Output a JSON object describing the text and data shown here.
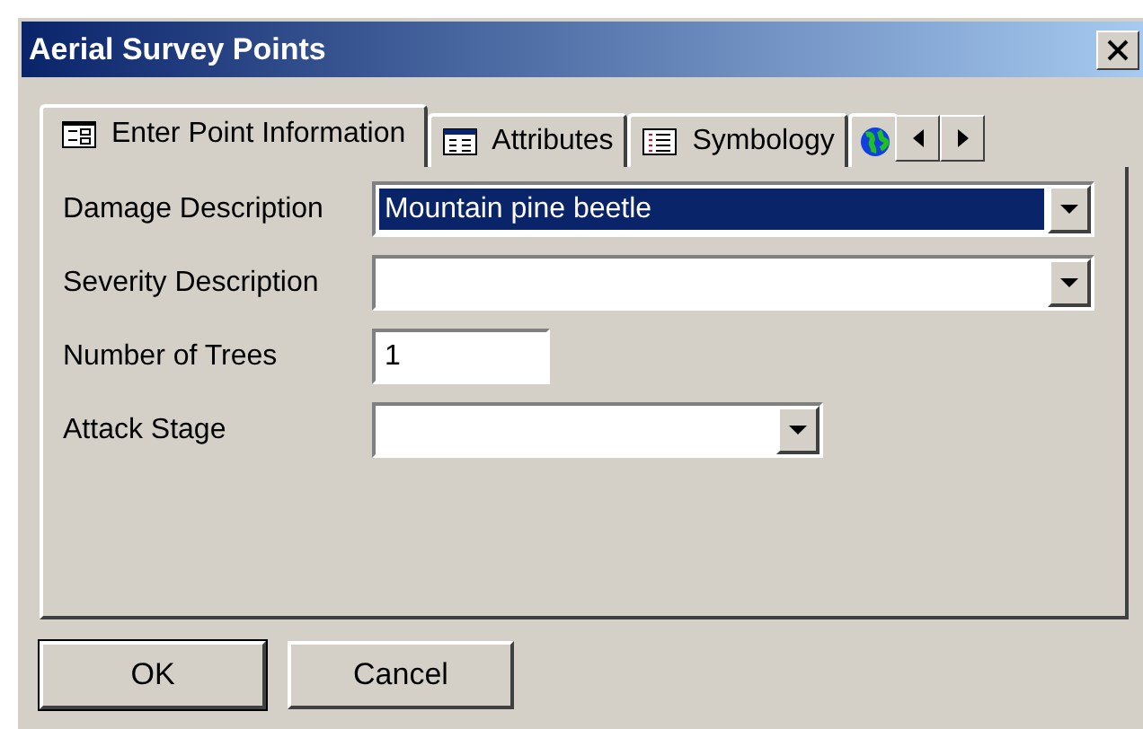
{
  "window": {
    "title": "Aerial Survey Points"
  },
  "tabs": [
    {
      "label": "Enter Point Information",
      "selected": true
    },
    {
      "label": "Attributes",
      "selected": false
    },
    {
      "label": "Symbology",
      "selected": false
    },
    {
      "selected": false
    }
  ],
  "fields": [
    {
      "label": "Damage Description",
      "kind": "combo",
      "value": "Mountain pine beetle",
      "highlighted": true
    },
    {
      "label": "Severity Description",
      "kind": "combo",
      "highlighted": false
    },
    {
      "label": "Number of Trees",
      "kind": "text",
      "value": "1",
      "highlighted": false
    },
    {
      "label": "Attack Stage",
      "kind": "combo",
      "highlighted": false
    }
  ],
  "buttons": [
    {
      "label": "OK",
      "default": true
    },
    {
      "label": "Cancel",
      "default": false
    }
  ]
}
